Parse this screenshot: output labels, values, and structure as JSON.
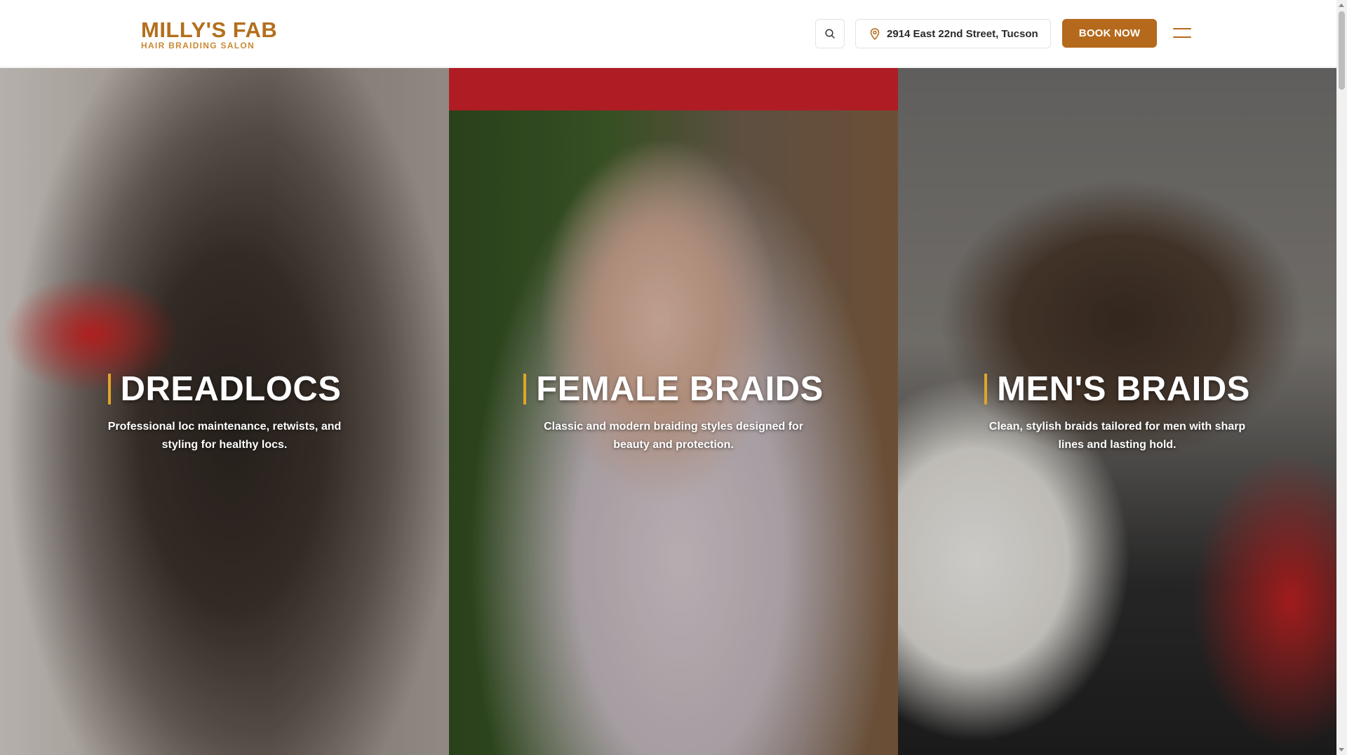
{
  "header": {
    "logo_name": "MILLY'S FAB",
    "logo_tagline": "HAIR BRAIDING SALON",
    "search_icon": "search-icon",
    "address_icon": "map-pin-icon",
    "address": "2914 East 22nd Street, Tucson",
    "book_label": "BOOK NOW",
    "menu_icon": "hamburger-menu-icon"
  },
  "panels": [
    {
      "title": "DREADLOCS",
      "description": "Professional loc maintenance, retwists, and styling for healthy locs."
    },
    {
      "title": "FEMALE BRAIDS",
      "description": "Classic and modern braiding styles designed for beauty and protection."
    },
    {
      "title": "MEN'S BRAIDS",
      "description": "Clean, stylish braids tailored for men with sharp lines and lasting hold."
    }
  ],
  "colors": {
    "brand": "#b36f1d",
    "button": "#b5691c",
    "accent_bar": "#e0a52a"
  }
}
